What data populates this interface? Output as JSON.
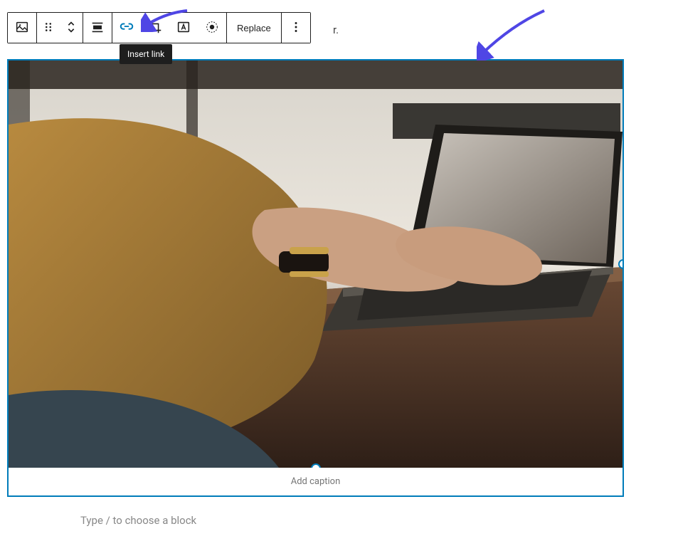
{
  "toolbar": {
    "image_block_icon": "image-block",
    "drag_icon": "drag-handle",
    "move_icon": "move-up-down",
    "align_icon": "align",
    "link_icon": "link",
    "crop_icon": "crop",
    "text_overlay_icon": "text-overlay",
    "duotone_icon": "duotone",
    "replace_label": "Replace",
    "more_icon": "more-options"
  },
  "tooltip": {
    "text": "Insert link"
  },
  "behind_text": "r.",
  "image_block": {
    "caption_placeholder": "Add caption"
  },
  "block_placeholder": {
    "text": "Type / to choose a block"
  },
  "colors": {
    "accent": "#007cba",
    "annotation": "#4f46e5"
  }
}
